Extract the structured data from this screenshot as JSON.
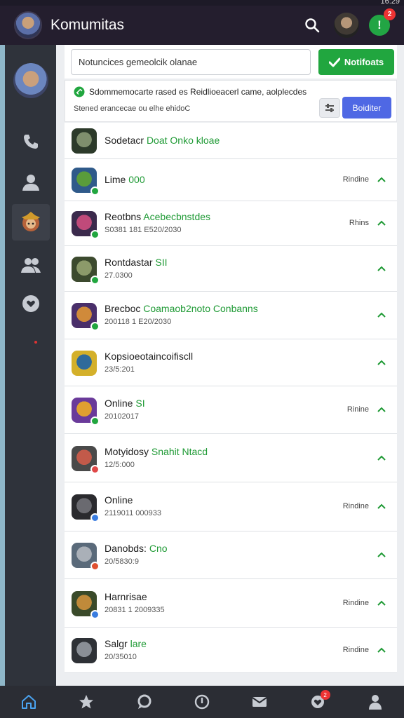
{
  "status_bar": {
    "time": "16:29"
  },
  "header": {
    "title": "Komumitas",
    "alert_badge": "2"
  },
  "top_panel": {
    "input_value": "Notuncices gemeolcik olanae",
    "notify_label": "Notifoats"
  },
  "info_card": {
    "line": "Sdommemocarte rased es Reidlioeacerl came, aolplecdes",
    "sub": "Stened erancecae ou elhe ehidoC",
    "button_label": "Boiditer"
  },
  "rows": [
    {
      "title": "Sodetacr",
      "tag": "Doat",
      "extra": " Onko kloae",
      "sub": "",
      "status": ""
    },
    {
      "title": "Lime",
      "tag": "000",
      "extra": "",
      "sub": "",
      "status": "Rindine"
    },
    {
      "title": "Reotbns",
      "tag": "Acebecbnstdes",
      "extra": "",
      "sub": "S0381 181 E520/2030",
      "status": "Rhins"
    },
    {
      "title": "Rontdastar",
      "tag": "SII",
      "extra": "",
      "sub": "27.0300",
      "status": ""
    },
    {
      "title": "Brecboc",
      "tag": "Coamaob2noto",
      "extra": " Conbanns",
      "sub": "200118 1 E20/2030",
      "status": ""
    },
    {
      "title": "Kopsioeotaincoifiscll",
      "tag": "",
      "extra": "",
      "sub": "23/5:201",
      "status": ""
    },
    {
      "title": "Online",
      "tag": "SI",
      "extra": "",
      "sub": "20102017",
      "status": "Rinine"
    },
    {
      "title": "Motyidosy",
      "tag": "Snahit Ntacd",
      "extra": "",
      "sub": "12/5:000",
      "status": ""
    },
    {
      "title": "Online",
      "tag": "",
      "extra": "",
      "sub": "2119011 000933",
      "status": "Rindine"
    },
    {
      "title": "Danobds:",
      "tag": "Cno",
      "extra": "",
      "sub": "20/5830:9",
      "status": ""
    },
    {
      "title": "Harnrisae",
      "tag": "",
      "extra": "",
      "sub": "20831 1 2009335",
      "status": "Rindine"
    },
    {
      "title": "Salgr",
      "tag": "lare",
      "extra": "",
      "sub": "20/35010",
      "status": "Rindine"
    }
  ],
  "bottom_nav": {
    "badge": "2"
  },
  "colors": {
    "accent_green": "#21a63f",
    "accent_blue": "#4f68e4",
    "header_bg": "#241e2e",
    "sidebar_bg": "#2f333b"
  }
}
